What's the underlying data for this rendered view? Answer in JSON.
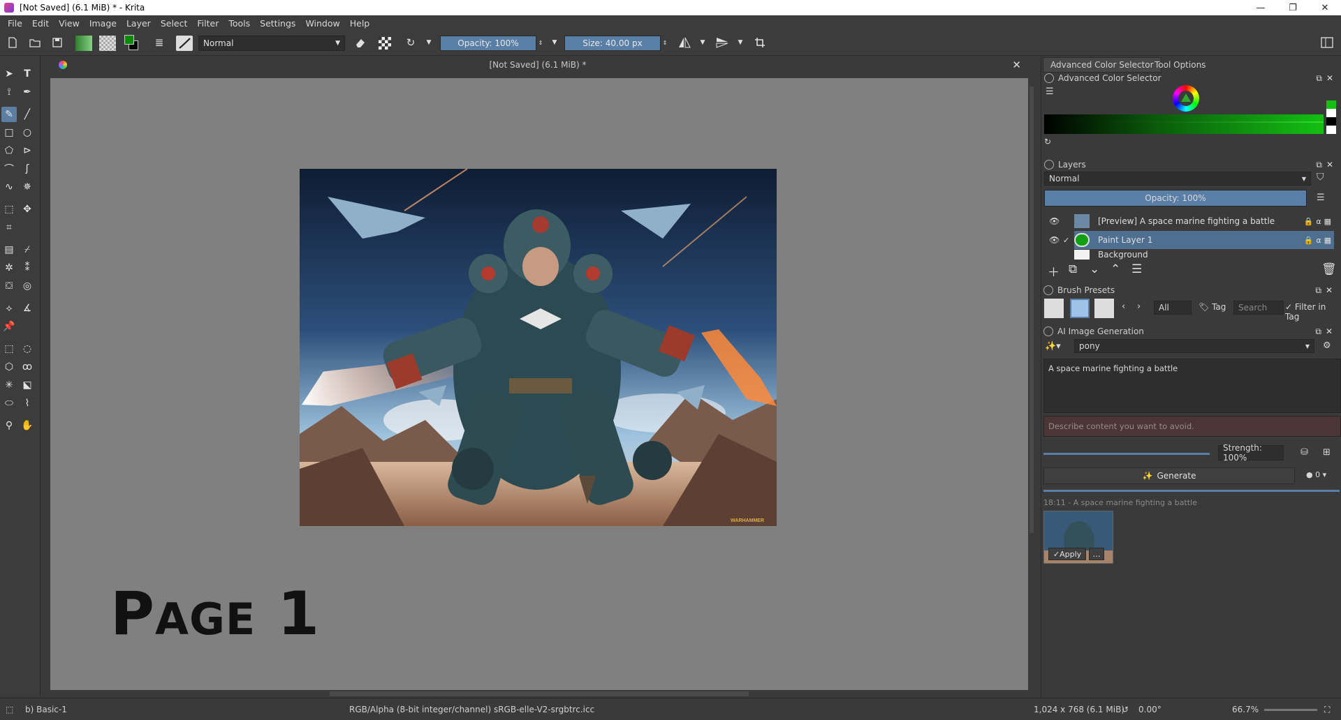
{
  "window": {
    "title": "[Not Saved]  (6.1 MiB) * - Krita",
    "controls": [
      "—",
      "❐",
      "✕"
    ]
  },
  "menu": [
    "File",
    "Edit",
    "View",
    "Image",
    "Layer",
    "Select",
    "Filter",
    "Tools",
    "Settings",
    "Window",
    "Help"
  ],
  "toolbar": {
    "blend_mode": "Normal",
    "opacity": "Opacity: 100%",
    "size": "Size: 40.00 px",
    "colors": {
      "foreground": "#0a8a0a",
      "background": "#000000",
      "accent": "#5a7fa6"
    }
  },
  "document": {
    "tab_title": "[Not Saved]  (6.1 MiB) *",
    "page_label_first": "P",
    "page_label_rest": "AGE",
    "page_label_num": "1",
    "artwork_watermark": "WARHAMMER"
  },
  "dock": {
    "tabs": [
      "Advanced Color Selector",
      "Tool Options"
    ],
    "color_selector_title": "Advanced Color Selector",
    "layers": {
      "title": "Layers",
      "blend_mode": "Normal",
      "opacity": "Opacity:  100%",
      "items": [
        {
          "name": "[Preview] A space marine fighting a battle",
          "selected": false
        },
        {
          "name": "Paint Layer 1",
          "selected": true
        },
        {
          "name": "Background",
          "selected": false
        }
      ]
    },
    "brush_presets": {
      "title": "Brush Presets",
      "tag_filter": "All",
      "tag_label": "Tag",
      "search_placeholder": "Search",
      "filter_in_tag": "Filter in Tag"
    },
    "ai": {
      "title": "AI Image Generation",
      "model": "pony",
      "prompt": "A space marine fighting a battle",
      "negative_placeholder": "Describe content you want to avoid.",
      "strength": "Strength: 100%",
      "generate_label": "Generate",
      "queue_count": "0",
      "history_label": "18:11 - A space marine fighting a battle",
      "apply_label": "Apply"
    }
  },
  "status": {
    "brush": "b) Basic-1",
    "color_space": "RGB/Alpha (8-bit integer/channel)  sRGB-elle-V2-srgbtrc.icc",
    "dimensions": "1,024 x 768 (6.1 MiB)",
    "rotation": "0.00°",
    "zoom": "66.7%"
  }
}
